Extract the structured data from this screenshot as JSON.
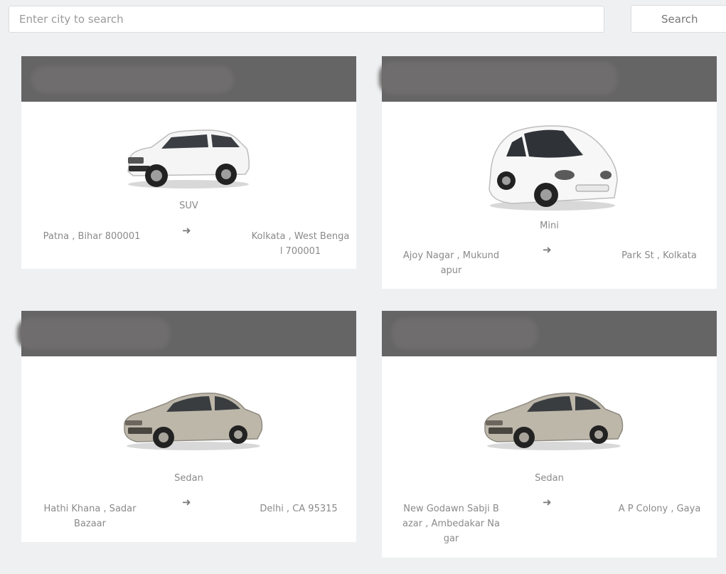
{
  "search": {
    "placeholder": "Enter city to search",
    "button_label": "Search"
  },
  "cards": [
    {
      "car_type": "SUV",
      "arrow": "➜",
      "from": "Patna , Bihar 800001",
      "to": "Kolkata , West Benga\nl 700001"
    },
    {
      "car_type": "Mini",
      "arrow": "➜",
      "from": "Ajoy Nagar , Mukund\napur",
      "to": "Park St , Kolkata"
    },
    {
      "car_type": "Sedan",
      "arrow": "➜",
      "from": "Hathi Khana , Sadar\nBazaar",
      "to": "Delhi , CA 95315"
    },
    {
      "car_type": "Sedan",
      "arrow": "➜",
      "from": "New Godawn Sabji B\nazar , Ambedakar Na\ngar",
      "to": "A P Colony , Gaya"
    }
  ],
  "colors": {
    "page_bg": "#eef0f2",
    "card_header": "#666565",
    "card_bg": "#ffffff",
    "text": "#8a8a8a"
  },
  "icons": {
    "arrow": "arrow-right-icon"
  }
}
